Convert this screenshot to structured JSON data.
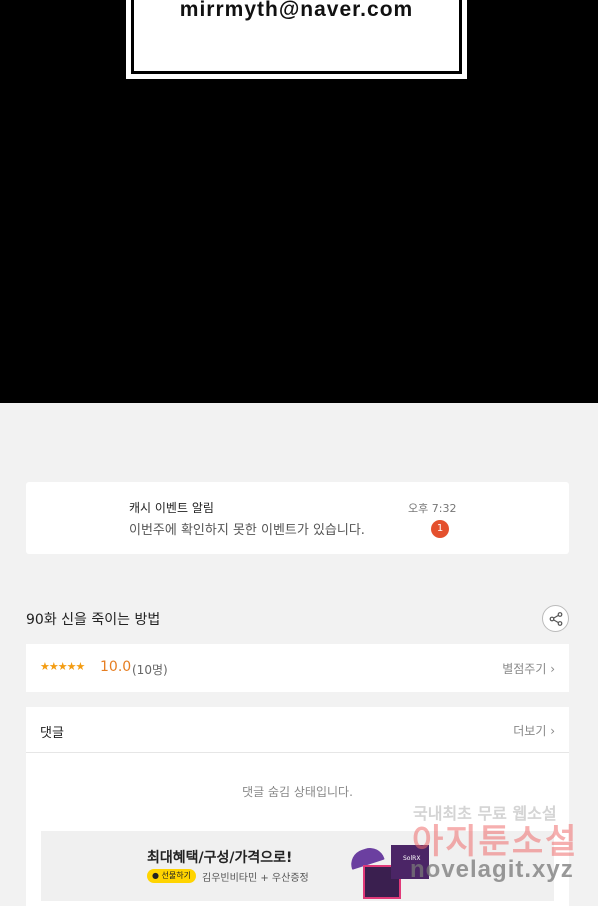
{
  "comic": {
    "email": "mirrmyth@naver.com"
  },
  "notification": {
    "title": "캐시 이벤트 알림",
    "message": "이번주에 확인하지 못한 이벤트가 있습니다.",
    "time": "오후 7:32",
    "badge": "1"
  },
  "episode": {
    "title": "90화 신을 죽이는 방법",
    "share_icon": "share-icon"
  },
  "rating": {
    "stars": "★★★★★",
    "score": "10.0",
    "count": "(10명)",
    "rate_link": "별점주기 ›",
    "star_color": "#f39c12"
  },
  "comments": {
    "title": "댓글",
    "more": "더보기 ›",
    "hidden_message": "댓글 숨김 상태입니다."
  },
  "ad": {
    "headline": "최대혜택/구성/가격으로!",
    "pill": "● 선물하기",
    "sub": "김우빈비타민 + 우산증정",
    "product_label": "SolRX"
  },
  "watermark": {
    "line1": "국내최초 무료 웹소설",
    "line2": "아지툰소설",
    "line3": "novelagit.xyz"
  },
  "colors": {
    "badge": "#e4502d",
    "score": "#e67e22",
    "pill": "#ffd400"
  }
}
